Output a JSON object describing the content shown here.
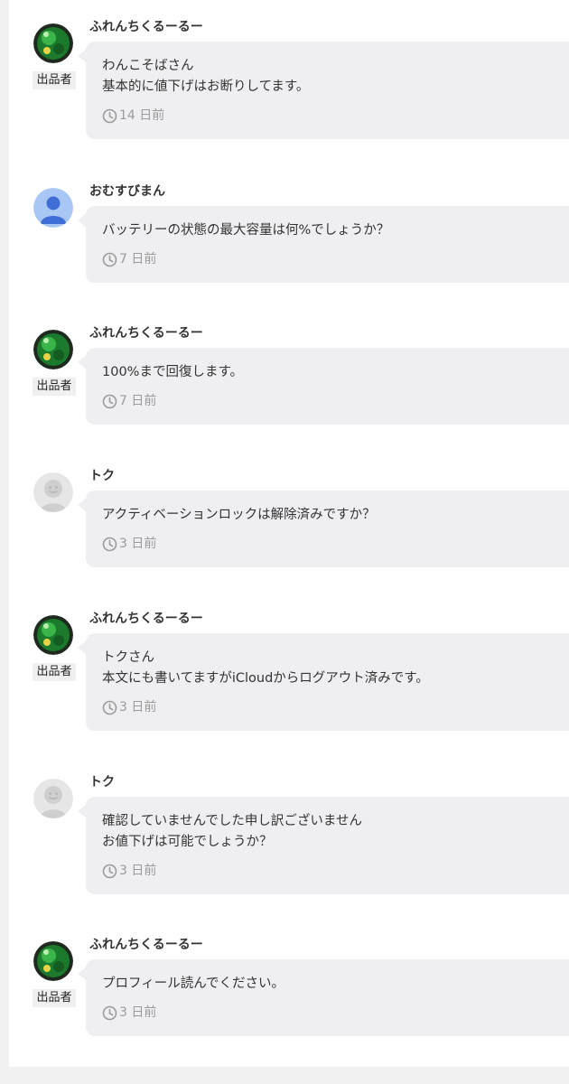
{
  "seller_badge_label": "出品者",
  "comments": [
    {
      "username": "ふれんちくるーるー",
      "is_seller": true,
      "avatar": "green-ball-avatar",
      "message": "わんこそばさん\n基本的に値下げはお断りしてます。",
      "time": "14 日前"
    },
    {
      "username": "おむすびまん",
      "is_seller": false,
      "avatar": "blue-person-avatar",
      "message": "バッテリーの状態の最大容量は何%でしょうか？",
      "time": "7 日前"
    },
    {
      "username": "ふれんちくるーるー",
      "is_seller": true,
      "avatar": "green-ball-avatar",
      "message": "100%まで回復します。",
      "time": "7 日前"
    },
    {
      "username": "トク",
      "is_seller": false,
      "avatar": "gray-face-avatar",
      "message": "アクティベーションロックは解除済みですか？",
      "time": "3 日前"
    },
    {
      "username": "ふれんちくるーるー",
      "is_seller": true,
      "avatar": "green-ball-avatar",
      "message": "トクさん\n本文にも書いてますがiCloudからログアウト済みです。",
      "time": "3 日前"
    },
    {
      "username": "トク",
      "is_seller": false,
      "avatar": "gray-face-avatar",
      "message": "確認していませんでした申し訳ございません\nお値下げは可能でしょうか？",
      "time": "3 日前"
    },
    {
      "username": "ふれんちくるーるー",
      "is_seller": true,
      "avatar": "green-ball-avatar",
      "message": "プロフィール読んでください。",
      "time": "3 日前"
    }
  ],
  "colors": {
    "bubble": "#efeff2",
    "timestamp": "#9b9b9b",
    "page_bg": "#f1f1f1"
  }
}
